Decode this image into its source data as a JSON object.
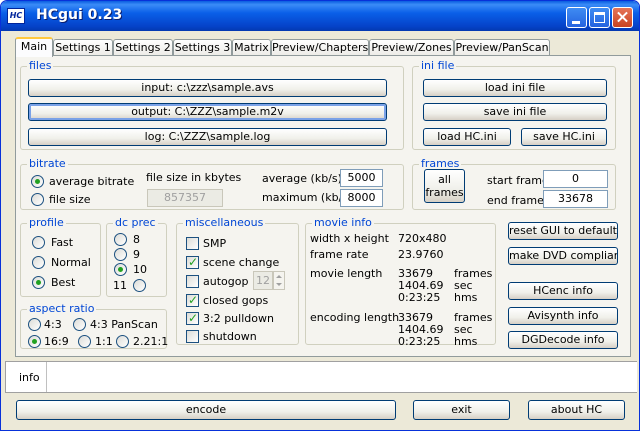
{
  "window": {
    "title": "HCgui 0.23",
    "icon_text": "HC"
  },
  "tabs": [
    {
      "label": "Main"
    },
    {
      "label": "Settings 1"
    },
    {
      "label": "Settings 2"
    },
    {
      "label": "Settings 3"
    },
    {
      "label": "Matrix"
    },
    {
      "label": "Preview/Chapters"
    },
    {
      "label": "Preview/Zones"
    },
    {
      "label": "Preview/PanScan"
    }
  ],
  "files": {
    "title": "files",
    "input": "input: c:\\zzz\\sample.avs",
    "output": "output: C:\\ZZZ\\sample.m2v",
    "log": "log: C:\\ZZZ\\sample.log"
  },
  "ini_file": {
    "title": "ini file",
    "load": "load ini file",
    "save": "save ini file",
    "load_hc": "load HC.ini",
    "save_hc": "save HC.ini"
  },
  "bitrate": {
    "title": "bitrate",
    "average_label": "average bitrate",
    "filesize_label": "file size",
    "selected": "average",
    "size_caption": "file size in kbytes",
    "size_value": "857357",
    "average_kbs_label": "average (kb/s)",
    "average_kbs": "5000",
    "max_kbs_label": "maximum (kb/s)",
    "max_kbs": "8000"
  },
  "frames": {
    "title": "frames",
    "all_line1": "all",
    "all_line2": "frames",
    "start_label": "start frame",
    "start": "0",
    "end_label": "end frame",
    "end": "33678"
  },
  "profile": {
    "title": "profile",
    "options": [
      "Fast",
      "Normal",
      "Best"
    ],
    "selected": "Best"
  },
  "dc_prec": {
    "title": "dc prec",
    "options": [
      "8",
      "9",
      "10",
      "11"
    ],
    "selected": "10"
  },
  "misc": {
    "title": "miscellaneous",
    "smp": "SMP",
    "scene_change": "scene change",
    "autogop": "autogop",
    "autogop_value": "12",
    "closed_gops": "closed gops",
    "pulldown": "3:2 pulldown",
    "shutdown": "shutdown",
    "checked": [
      "scene change",
      "closed gops",
      "3:2 pulldown"
    ]
  },
  "movie_info": {
    "title": "movie info",
    "wh_label": "width x height",
    "wh": "720x480",
    "fr_label": "frame rate",
    "fr": "23.9760",
    "ml_label": "movie length",
    "ml_frames": "33679",
    "ml_sec": "1404.69",
    "ml_hms": "0:23:25",
    "el_label": "encoding length",
    "el_frames": "33679",
    "el_sec": "1404.69",
    "el_hms": "0:23:25",
    "unit_frames": "frames",
    "unit_sec": "sec",
    "unit_hms": "hms"
  },
  "aspect": {
    "title": "aspect ratio",
    "options": [
      "4:3",
      "4:3 PanScan",
      "16:9",
      "1:1",
      "2.21:1"
    ],
    "selected": "16:9"
  },
  "side_buttons": {
    "reset": "reset GUI to default",
    "dvd": "make DVD compliant",
    "hcenc": "HCenc info",
    "avisynth": "Avisynth info",
    "dgdecode": "DGDecode info"
  },
  "info": {
    "label": "info"
  },
  "bottom": {
    "encode": "encode",
    "exit": "exit",
    "about": "about HC"
  }
}
